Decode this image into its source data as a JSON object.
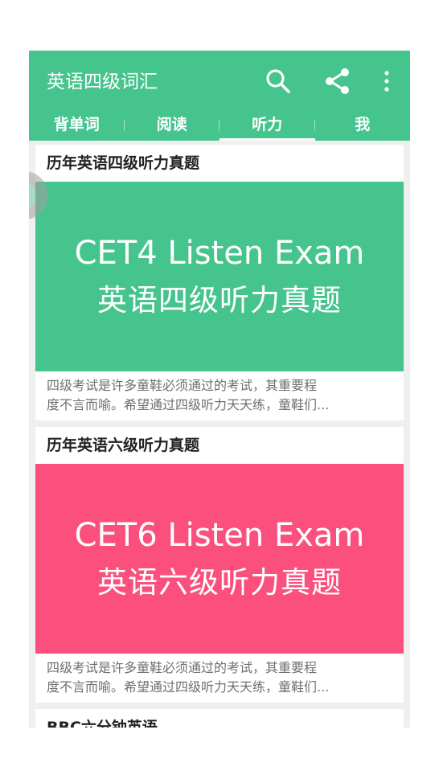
{
  "app": {
    "title": "英语四级词汇"
  },
  "toolbar": {
    "search_icon": "search-icon",
    "share_icon": "share-icon",
    "more_icon": "more-vert-icon"
  },
  "tabs": [
    {
      "label": "背单词",
      "active": false
    },
    {
      "label": "阅读",
      "active": false
    },
    {
      "label": "听力",
      "active": true
    },
    {
      "label": "我",
      "active": false
    }
  ],
  "cards": [
    {
      "title": "历年英语四级听力真题",
      "banner_en": "CET4 Listen Exam",
      "banner_cn": "英语四级听力真题",
      "banner_color": "#45c48e",
      "desc_line1": "四级考试是许多童鞋必须通过的考试，其重要程",
      "desc_line2": "度不言而喻。希望通过四级听力天天练，童鞋们..."
    },
    {
      "title": "历年英语六级听力真题",
      "banner_en": "CET6 Listen Exam",
      "banner_cn": "英语六级听力真题",
      "banner_color": "#fb4f7e",
      "desc_line1": "四级考试是许多童鞋必须通过的考试，其重要程",
      "desc_line2": "度不言而喻。希望通过四级听力天天练，童鞋们..."
    },
    {
      "title": "BBC六分钟英语"
    }
  ],
  "colors": {
    "primary": "#45c48e",
    "pink": "#fb4f7e",
    "background": "#efefef"
  }
}
